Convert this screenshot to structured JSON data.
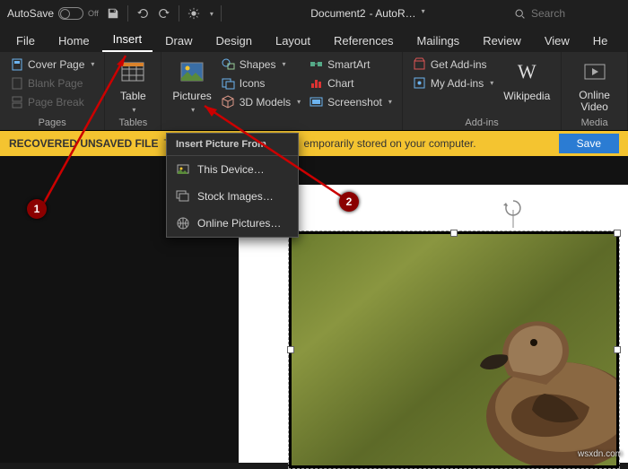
{
  "titlebar": {
    "autosave_label": "AutoSave",
    "autosave_state": "Off",
    "doc_name": "Document2",
    "doc_suffix": " - AutoR…",
    "search_placeholder": "Search"
  },
  "tabs": [
    "File",
    "Home",
    "Insert",
    "Draw",
    "Design",
    "Layout",
    "References",
    "Mailings",
    "Review",
    "View",
    "He"
  ],
  "active_tab": 2,
  "ribbon": {
    "pages": {
      "cover": "Cover Page",
      "blank": "Blank Page",
      "break": "Page Break",
      "label": "Pages"
    },
    "tables": {
      "table": "Table",
      "label": "Tables"
    },
    "illustrations": {
      "pictures": "Pictures",
      "shapes": "Shapes",
      "icons": "Icons",
      "models": "3D Models",
      "smartart": "SmartArt",
      "chart": "Chart",
      "screenshot": "Screenshot"
    },
    "addins": {
      "get": "Get Add-ins",
      "my": "My Add-ins",
      "wiki": "Wikipedia",
      "label": "Add-ins"
    },
    "media": {
      "video": "Online Video",
      "label": "Media"
    }
  },
  "dropdown": {
    "header": "Insert Picture From",
    "items": [
      "This Device…",
      "Stock Images…",
      "Online Pictures…"
    ]
  },
  "recover": {
    "title": "RECOVERED UNSAVED FILE",
    "msg_left": "Tl",
    "msg_right": "emporarily stored on your computer.",
    "save": "Save"
  },
  "callouts": {
    "one": "1",
    "two": "2"
  },
  "watermark": "wsxdn.com"
}
